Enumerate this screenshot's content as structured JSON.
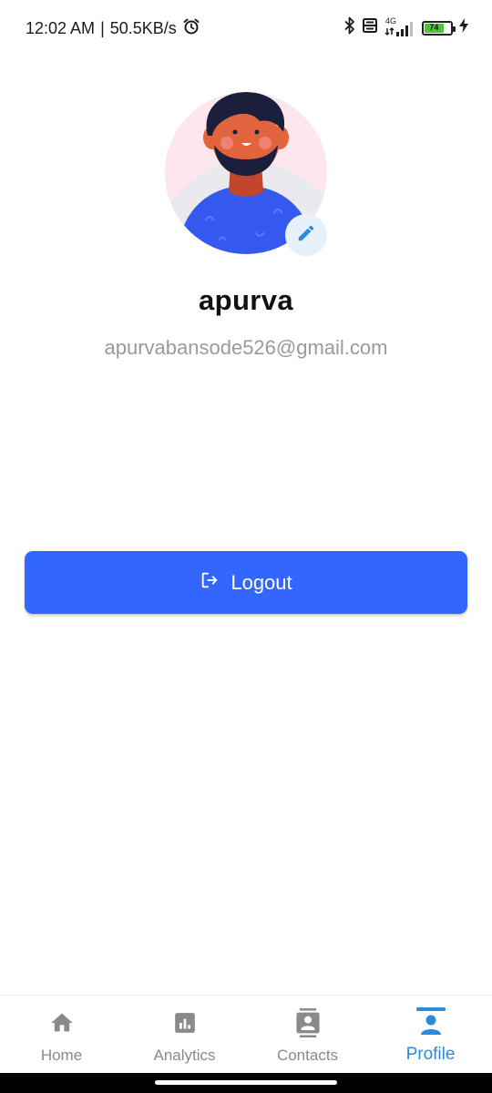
{
  "status_bar": {
    "time": "12:02 AM",
    "separator": "|",
    "network_speed": "50.5KB/s",
    "alarm_icon": "alarm-clock-icon",
    "bluetooth_icon": "bluetooth-icon",
    "volte_icon": "volte-icon",
    "network_type": "4G",
    "signal_icon": "signal-bars-icon",
    "battery_level": "74",
    "charging_icon": "lightning-icon"
  },
  "profile": {
    "name": "apurva",
    "email": "apurvabansode526@gmail.com",
    "avatar_icon": "avatar-illustration",
    "edit_icon": "pencil-icon"
  },
  "actions": {
    "logout_label": "Logout",
    "logout_icon": "logout-icon"
  },
  "bottom_nav": {
    "items": [
      {
        "label": "Home",
        "icon": "home-icon",
        "active": false
      },
      {
        "label": "Analytics",
        "icon": "analytics-icon",
        "active": false
      },
      {
        "label": "Contacts",
        "icon": "contacts-icon",
        "active": false
      },
      {
        "label": "Profile",
        "icon": "profile-icon",
        "active": true
      }
    ]
  },
  "colors": {
    "primary": "#3366ff",
    "nav_active": "#2a8cdb",
    "nav_inactive": "#8a8a8a",
    "email_text": "#9a9a9a",
    "battery_fill": "#4fc43a"
  }
}
